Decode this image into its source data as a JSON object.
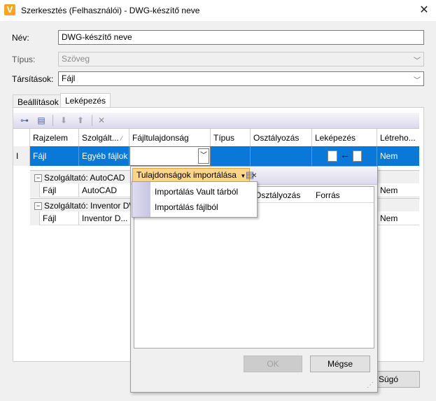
{
  "window": {
    "title": "Szerkesztés (Felhasználói) - DWG-készítő neve",
    "app_icon_letter": "V"
  },
  "form": {
    "name_label": "Név:",
    "name_value": "DWG-készítő neve",
    "type_label": "Típus:",
    "type_value": "Szöveg",
    "assoc_label": "Társítások:",
    "assoc_value": "Fájl"
  },
  "tabs": [
    {
      "label": "Beállítások"
    },
    {
      "label": "Leképezés"
    }
  ],
  "grid": {
    "columns": [
      "Rajzelem",
      "Szolgált...",
      "Fájltulajdonság",
      "Típus",
      "Osztályozás",
      "Leképezés",
      "Létreho..."
    ],
    "selected_row": {
      "indicator": "I",
      "entity": "Fájl",
      "provider": "Egyéb fájlok",
      "property": "",
      "type": "",
      "classification": "",
      "create": "Nem"
    },
    "groups": [
      {
        "title": "Szolgáltató: AutoCAD",
        "row": {
          "entity": "Fájl",
          "provider": "AutoCAD",
          "create": "Nem"
        }
      },
      {
        "title": "Szolgáltató: Inventor DWG",
        "row": {
          "entity": "Fájl",
          "provider": "Inventor D...",
          "create": "Nem"
        }
      }
    ]
  },
  "popup": {
    "import_button": "Tulajdonságok importálása",
    "columns": [
      "Osztályozás",
      "Forrás"
    ],
    "ok_label": "OK",
    "cancel_label": "Mégse"
  },
  "menu": {
    "items": [
      "Importálás Vault tárból",
      "Importálás fájlból"
    ]
  },
  "help_button": "Súgó",
  "colors": {
    "selection": "#0a78d7",
    "import_highlight": "#fcd48a",
    "app_icon": "#f5a623"
  }
}
